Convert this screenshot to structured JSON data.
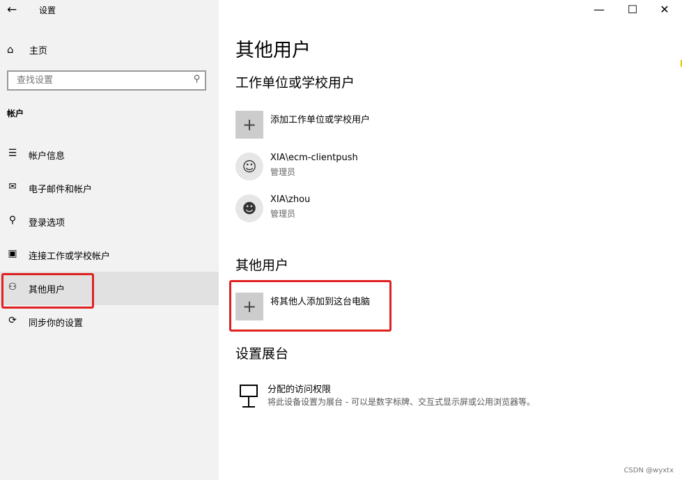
{
  "window": {
    "title": "设置",
    "back_icon": "←",
    "minimize": "—",
    "maximize": "☐",
    "close": "✕"
  },
  "sidebar": {
    "home_label": "主页",
    "search_placeholder": "查找设置",
    "section_title": "帐户",
    "items": [
      {
        "label": "帐户信息",
        "icon": "account-info-icon",
        "glyph": "☰"
      },
      {
        "label": "电子邮件和帐户",
        "icon": "mail-icon",
        "glyph": "✉"
      },
      {
        "label": "登录选项",
        "icon": "key-icon",
        "glyph": "⚲"
      },
      {
        "label": "连接工作或学校帐户",
        "icon": "briefcase-icon",
        "glyph": "▣"
      },
      {
        "label": "其他用户",
        "icon": "add-person-icon",
        "glyph": "⚇",
        "selected": true
      },
      {
        "label": "同步你的设置",
        "icon": "sync-icon",
        "glyph": "⟳"
      }
    ]
  },
  "main": {
    "title": "其他用户",
    "work_section": {
      "heading": "工作单位或学校用户",
      "add_label": "添加工作单位或学校用户",
      "users": [
        {
          "name": "XIA\\ecm-clientpush",
          "role": "管理员"
        },
        {
          "name": "XIA\\zhou",
          "role": "管理员"
        }
      ]
    },
    "other_section": {
      "heading": "其他用户",
      "add_label": "将其他人添加到这台电脑"
    },
    "kiosk_section": {
      "heading": "设置展台",
      "title": "分配的访问权限",
      "description": "将此设备设置为展台 - 可以是数字标牌、交互式显示屏或公用浏览器等。"
    }
  },
  "watermark": "CSDN @wyxtx",
  "colors": {
    "highlight_border": "#e02020",
    "sidebar_bg": "#f2f2f2",
    "selected_bg": "#e1e1e1"
  }
}
